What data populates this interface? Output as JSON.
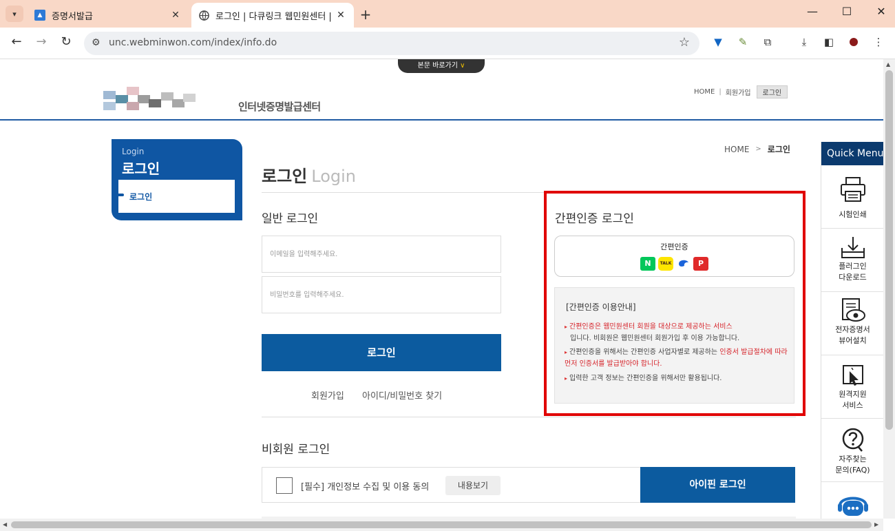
{
  "browser": {
    "tabs": [
      {
        "title": "증명서발급"
      },
      {
        "title": "로그인 | 다큐링크 웹민원센터 |"
      }
    ],
    "url": "unc.webminwon.com/index/info.do"
  },
  "header": {
    "skip_link": "본문 바로가기",
    "skip_arrow": "∨",
    "site_subtitle": "인터넷증명발급센터",
    "util_nav": {
      "home": "HOME",
      "join": "회원가입",
      "login": "로그인"
    }
  },
  "lnb": {
    "sub_title": "Login",
    "title": "로그인",
    "items": [
      {
        "label": "로그인"
      }
    ]
  },
  "breadcrumb": {
    "home": "HOME",
    "sep": ">",
    "current": "로그인"
  },
  "main": {
    "title": "로그인",
    "title_en": "Login",
    "general_login": {
      "title": "일반 로그인",
      "email_placeholder": "이메일을 입력해주세요.",
      "password_placeholder": "비밀번호를 입력해주세요.",
      "login_button": "로그인",
      "join_link": "회원가입",
      "find_link": "아이디/비밀번호 찾기"
    },
    "simple_login": {
      "title": "간편인증 로그인",
      "button_label": "간편인증",
      "providers": [
        {
          "name": "naver",
          "label": "N",
          "color": "#03c75a"
        },
        {
          "name": "kakao",
          "label": "TALK",
          "color": "#fee500"
        },
        {
          "name": "toss",
          "label": "",
          "color": "#1b64da"
        },
        {
          "name": "payco",
          "label": "P",
          "color": "#e02a2a"
        }
      ],
      "guide_title": "[간편인증 이용안내]",
      "guide_items": [
        {
          "red": "간편인증은 웹민원센터 회원을 대상으로 제공하는 서비스",
          "normal": "입니다. 비회원은 웹민원센터 회원가입 후 이용 가능합니다."
        },
        {
          "normal": "간편인증을 위해서는 간편인증 사업자별로 제공하는 ",
          "red": "인증서 발급절차에 따라 먼저 인증서를 발급받아야 합니다."
        },
        {
          "normal": "입력한 고객 정보는 간편인증을 위해서만 활용됩니다."
        }
      ]
    },
    "nonmember": {
      "title": "비회원 로그인",
      "agree_label": "[필수] 개인정보 수집 및 이용 동의",
      "view_button": "내용보기",
      "ipin_button": "아이핀 로그인"
    }
  },
  "quick_menu": {
    "title": "Quick Menu",
    "items": [
      {
        "label1": "시험인쇄",
        "label2": ""
      },
      {
        "label1": "플러그인",
        "label2": "다운로드"
      },
      {
        "label1": "전자증명서",
        "label2": "뷰어설치"
      },
      {
        "label1": "원격지원",
        "label2": "서비스"
      },
      {
        "label1": "자주찾는",
        "label2": "문의(FAQ)"
      }
    ]
  },
  "colors": {
    "accent": "#0c5b9f",
    "highlight": "#e00000",
    "lnb": "#0f56a3",
    "quick_head": "#0b3a6e"
  }
}
